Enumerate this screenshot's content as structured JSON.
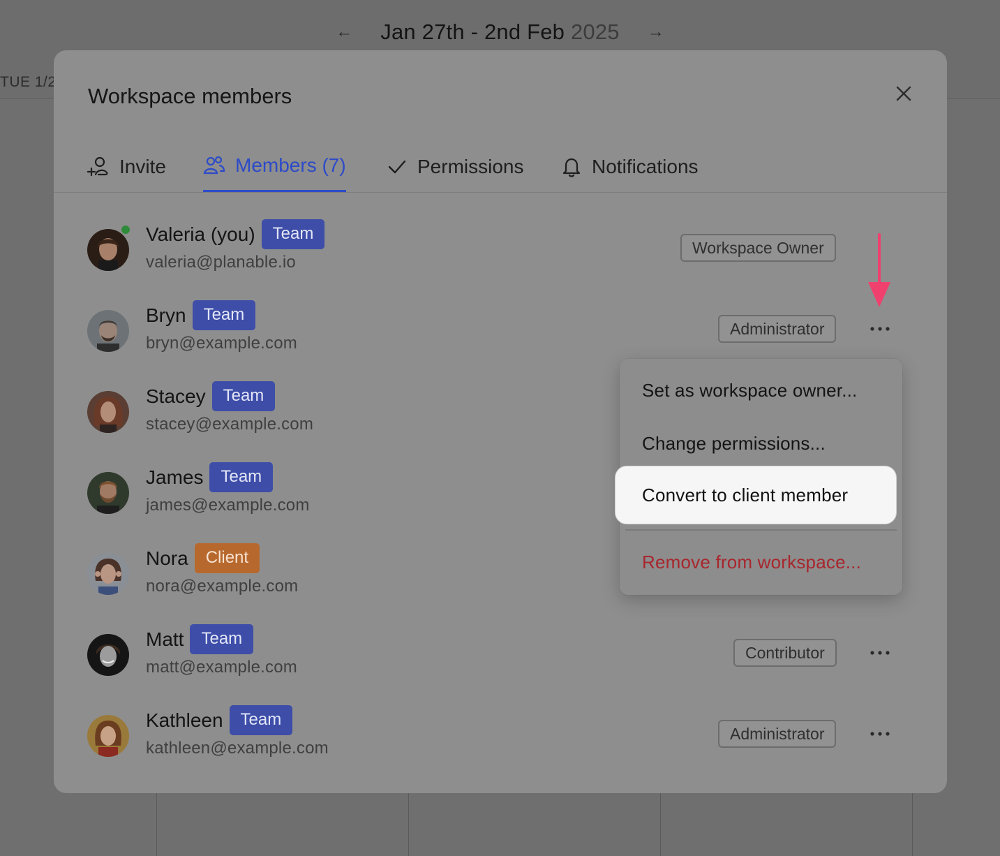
{
  "calendar": {
    "range_start": "Jan 27th - 2nd Feb",
    "range_year": "2025",
    "prev_arrow": "←",
    "next_arrow": "→",
    "day_label": "TUE 1/2"
  },
  "modal": {
    "title": "Workspace members",
    "close_icon": "close-icon"
  },
  "tabs": [
    {
      "label": "Invite",
      "icon": "add-user-icon",
      "active": false
    },
    {
      "label": "Members (7)",
      "icon": "users-icon",
      "active": true
    },
    {
      "label": "Permissions",
      "icon": "checkmark-icon",
      "active": false
    },
    {
      "label": "Notifications",
      "icon": "bell-icon",
      "active": false
    }
  ],
  "members": [
    {
      "name": "Valeria (you)",
      "badge": "Team",
      "email": "valeria@planable.io",
      "role": "Workspace Owner",
      "online": true
    },
    {
      "name": "Bryn",
      "badge": "Team",
      "email": "bryn@example.com",
      "role": "Administrator"
    },
    {
      "name": "Stacey",
      "badge": "Team",
      "email": "stacey@example.com",
      "role": ""
    },
    {
      "name": "James",
      "badge": "Team",
      "email": "james@example.com",
      "role": ""
    },
    {
      "name": "Nora",
      "badge": "Client",
      "email": "nora@example.com",
      "role": ""
    },
    {
      "name": "Matt",
      "badge": "Team",
      "email": "matt@example.com",
      "role": "Contributor"
    },
    {
      "name": "Kathleen",
      "badge": "Team",
      "email": "kathleen@example.com",
      "role": "Administrator"
    }
  ],
  "menu": {
    "items": [
      {
        "label": "Set as workspace owner..."
      },
      {
        "label": "Change permissions..."
      },
      {
        "label": "Convert to client member",
        "highlighted": true
      },
      {
        "label": "Remove from workspace...",
        "danger": true
      }
    ]
  },
  "colors": {
    "accent": "#2d4bc8",
    "team_badge": "#3d4da8",
    "client_badge": "#b7682d",
    "danger": "#a8262d",
    "annotation_arrow": "#f0416e"
  }
}
